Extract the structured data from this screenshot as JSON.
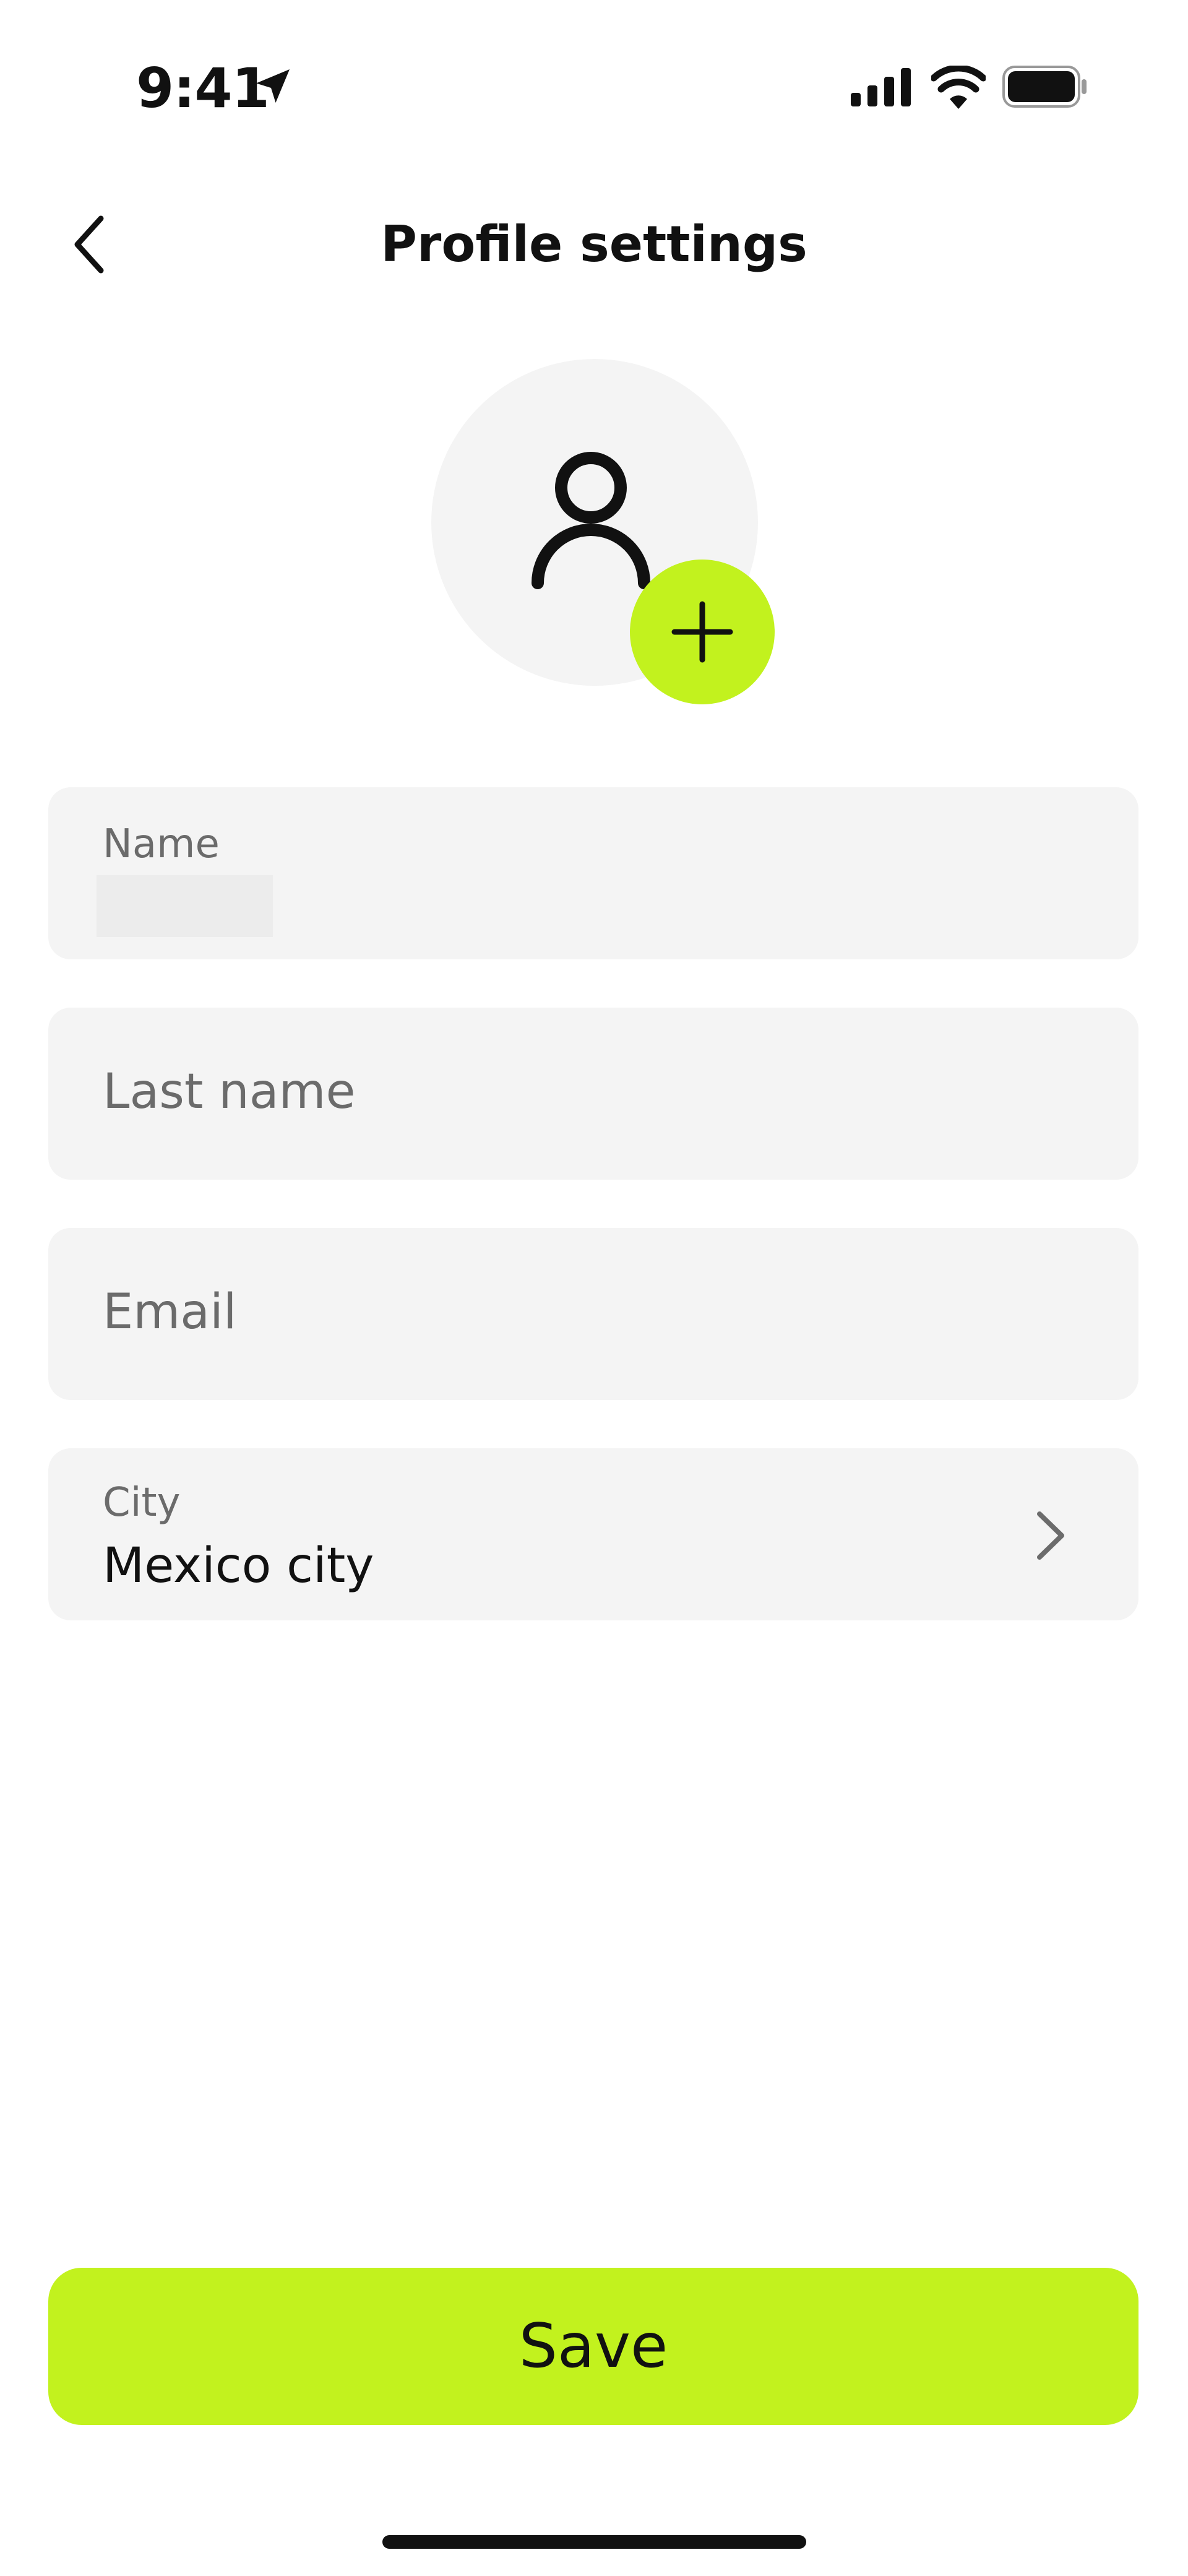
{
  "status_bar": {
    "time": "9:41",
    "icons": [
      "location-arrow-icon",
      "cellular-signal-icon",
      "wifi-icon",
      "battery-icon"
    ]
  },
  "header": {
    "title": "Profile settings",
    "back_icon": "chevron-left-icon"
  },
  "avatar": {
    "placeholder_icon": "user-icon",
    "add_icon": "plus-icon"
  },
  "form": {
    "name": {
      "label": "Name",
      "value": ""
    },
    "last_name": {
      "placeholder": "Last name"
    },
    "email": {
      "placeholder": "Email"
    },
    "city": {
      "label": "City",
      "value": "Mexico city",
      "icon": "chevron-right-icon"
    }
  },
  "actions": {
    "save_label": "Save"
  },
  "colors": {
    "accent": "#c2f21e",
    "field_background": "#f4f4f4",
    "text_primary": "#111111",
    "text_secondary": "#6b6b6b"
  }
}
